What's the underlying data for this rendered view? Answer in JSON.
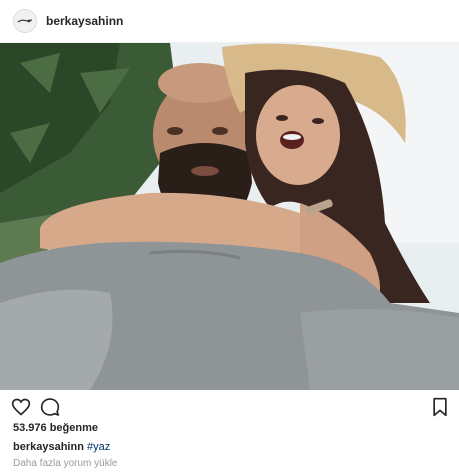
{
  "header": {
    "username": "berkaysahinn",
    "avatar_icon": "user-avatar"
  },
  "photo": {
    "alt": "selfie"
  },
  "actions": {
    "like_icon": "heart-icon",
    "comment_icon": "comment-icon",
    "save_icon": "bookmark-icon"
  },
  "likes": {
    "text": "53.976 beğenme"
  },
  "caption": {
    "username": "berkaysahinn",
    "hashtag": "#yaz"
  },
  "comments": {
    "load_more": "Daha fazla yorum yükle"
  }
}
